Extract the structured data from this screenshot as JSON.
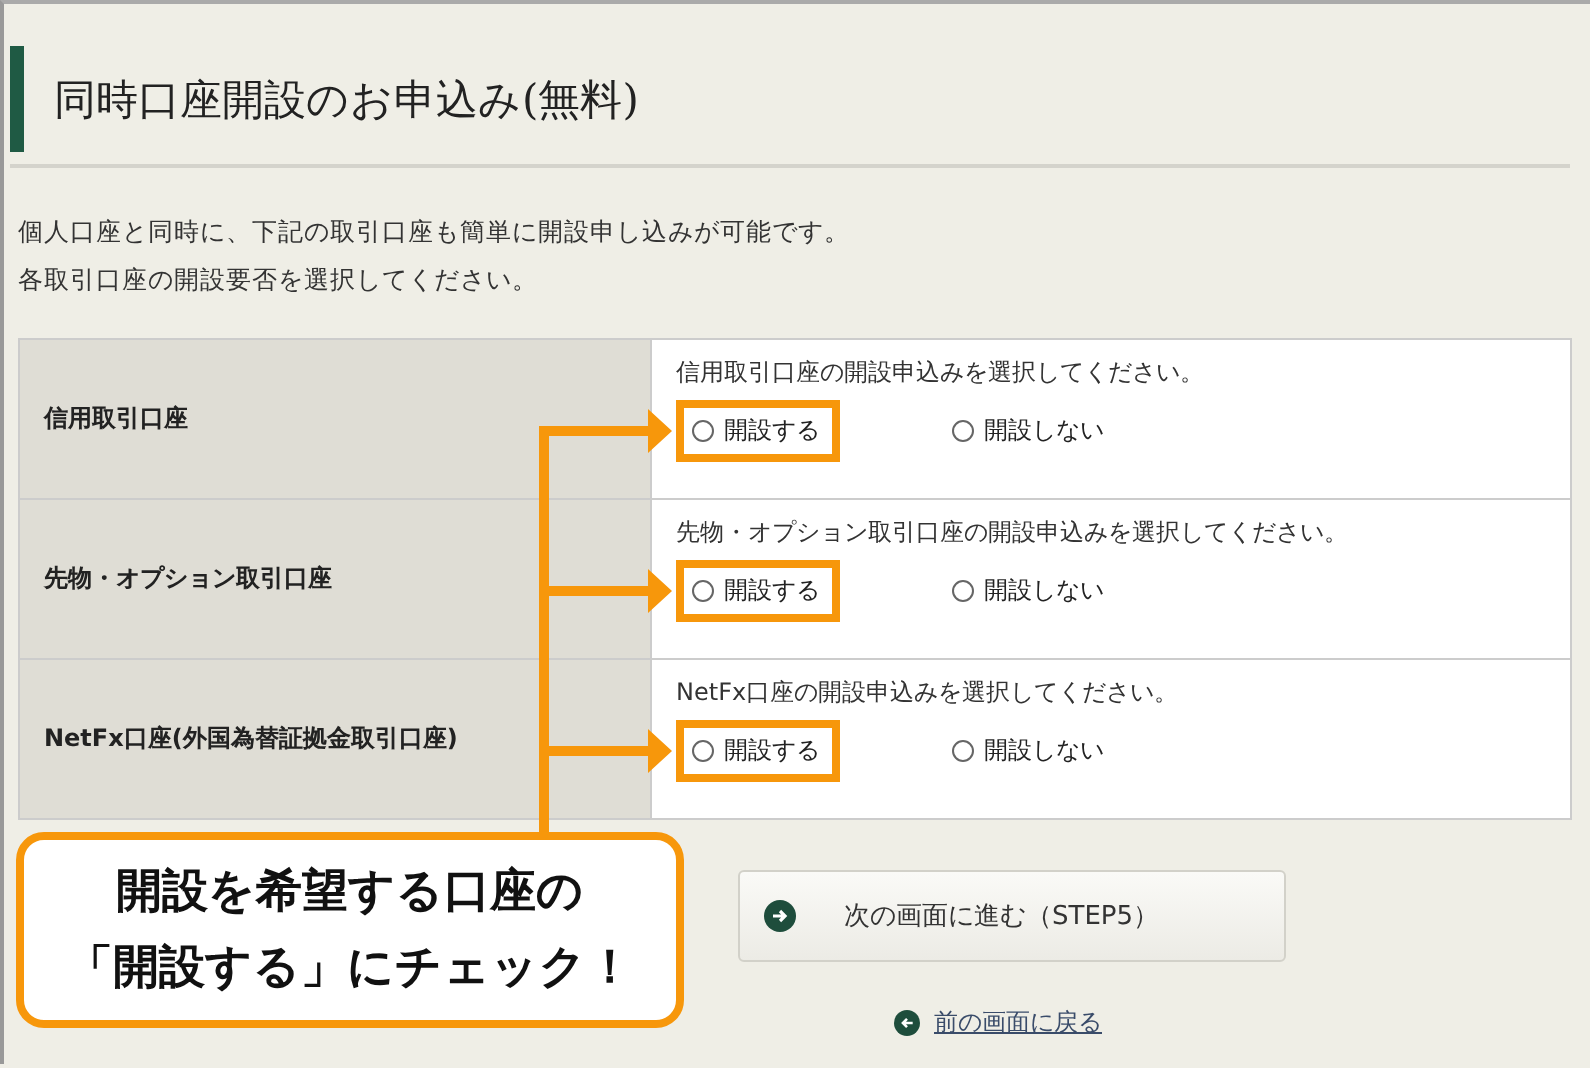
{
  "heading": {
    "title": "同時口座開設のお申込み(無料)"
  },
  "intro": [
    "個人口座と同時に、下記の取引口座も簡単に開設申し込みが可能です。",
    "各取引口座の開設要否を選択してください。"
  ],
  "accounts": [
    {
      "name": "信用取引口座",
      "prompt": "信用取引口座の開設申込みを選択してください。",
      "options": [
        {
          "label": "開設する",
          "selected": false,
          "highlighted": true
        },
        {
          "label": "開設しない",
          "selected": false,
          "highlighted": false
        }
      ]
    },
    {
      "name": "先物・オプション取引口座",
      "prompt": "先物・オプション取引口座の開設申込みを選択してください。",
      "options": [
        {
          "label": "開設する",
          "selected": false,
          "highlighted": true
        },
        {
          "label": "開設しない",
          "selected": false,
          "highlighted": false
        }
      ]
    },
    {
      "name": "NetFx口座(外国為替証拠金取引口座)",
      "prompt": "NetFx口座の開設申込みを選択してください。",
      "options": [
        {
          "label": "開設する",
          "selected": false,
          "highlighted": true
        },
        {
          "label": "開設しない",
          "selected": false,
          "highlighted": false
        }
      ]
    }
  ],
  "next_button": {
    "label": "次の画面に進む（STEP5）"
  },
  "back_link": {
    "label": "前の画面に戻る"
  },
  "callout": {
    "lines": [
      "開設を希望する口座の",
      "「開設する」にチェック！"
    ]
  }
}
